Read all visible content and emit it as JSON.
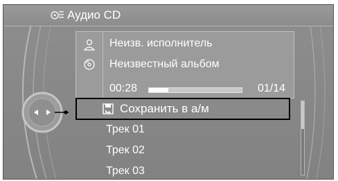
{
  "header": {
    "title": "Аудио CD",
    "icon": "media-source-icon"
  },
  "info": {
    "artist": "Неизв. исполнитель",
    "album": "Неизвестный альбом",
    "artist_icon": "person-icon",
    "album_icon": "disc-icon",
    "elapsed": "00:28",
    "track_count": "01/14",
    "progress_fraction": 0.21
  },
  "menu": {
    "selected": {
      "label": "Сохранить в а/м",
      "icon": "save-to-car-icon"
    },
    "items": [
      {
        "label": "Трек  01"
      },
      {
        "label": "Трек  02"
      },
      {
        "label": "Трек  03"
      }
    ]
  },
  "scroll": {
    "position_fraction": 0.0,
    "visible_fraction": 0.38
  },
  "colors": {
    "background": "#8e8e8e",
    "text": "#ffffff",
    "selection_border": "#000000"
  }
}
